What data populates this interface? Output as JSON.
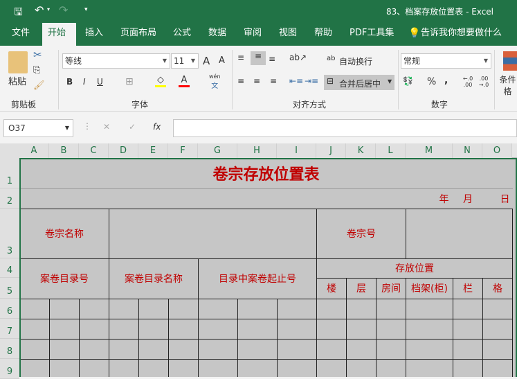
{
  "titlebar": {
    "doc_title": "83、档案存放位置表  -  Excel",
    "save_icon": "save-icon",
    "undo_icon": "undo-icon",
    "redo_icon": "redo-icon",
    "customize": "▾"
  },
  "tabs": [
    "文件",
    "开始",
    "插入",
    "页面布局",
    "公式",
    "数据",
    "审阅",
    "视图",
    "帮助",
    "PDF工具集"
  ],
  "tell_me": "告诉我你想要做什么",
  "ribbon": {
    "clipboard": {
      "paste": "粘贴",
      "label": "剪贴板"
    },
    "font": {
      "name": "等线",
      "size": "11",
      "bold": "B",
      "italic": "I",
      "underline": "U",
      "grow": "A",
      "shrink": "A",
      "font_color": "A",
      "phonetic_top": "wén",
      "phonetic_bottom": "文",
      "label": "字体"
    },
    "alignment": {
      "wrap": "自动换行",
      "merge": "合并后居中",
      "label": "对齐方式"
    },
    "number": {
      "format": "常规",
      "percent": "%",
      "comma": ",",
      "inc": "←.0 .00",
      "dec": ".00 →.0",
      "label": "数字"
    },
    "styles": {
      "conditional": "条件格"
    }
  },
  "formula_bar": {
    "name_box": "O37",
    "cancel": "✕",
    "enter": "✓",
    "fx": "fx",
    "value": ""
  },
  "columns": [
    "A",
    "B",
    "C",
    "D",
    "E",
    "F",
    "G",
    "H",
    "I",
    "J",
    "K",
    "L",
    "M",
    "N",
    "O"
  ],
  "rows": [
    "1",
    "2",
    "3",
    "4",
    "5",
    "6",
    "7",
    "8",
    "9"
  ],
  "sheet": {
    "title": "卷宗存放位置表",
    "year": "年",
    "month": "月",
    "day": "日",
    "volume_name": "卷宗名称",
    "volume_no": "卷宗号",
    "catalog_no": "案卷目录号",
    "catalog_name": "案卷目录名称",
    "catalog_range": "目录中案卷起止号",
    "location": "存放位置",
    "building": "楼",
    "floor": "层",
    "room": "房间",
    "shelf": "档架(柜)",
    "column": "栏",
    "cell": "格"
  },
  "colors": {
    "accent": "#217346",
    "text_red": "#c00000",
    "cell_bg": "#c6c6c6"
  }
}
